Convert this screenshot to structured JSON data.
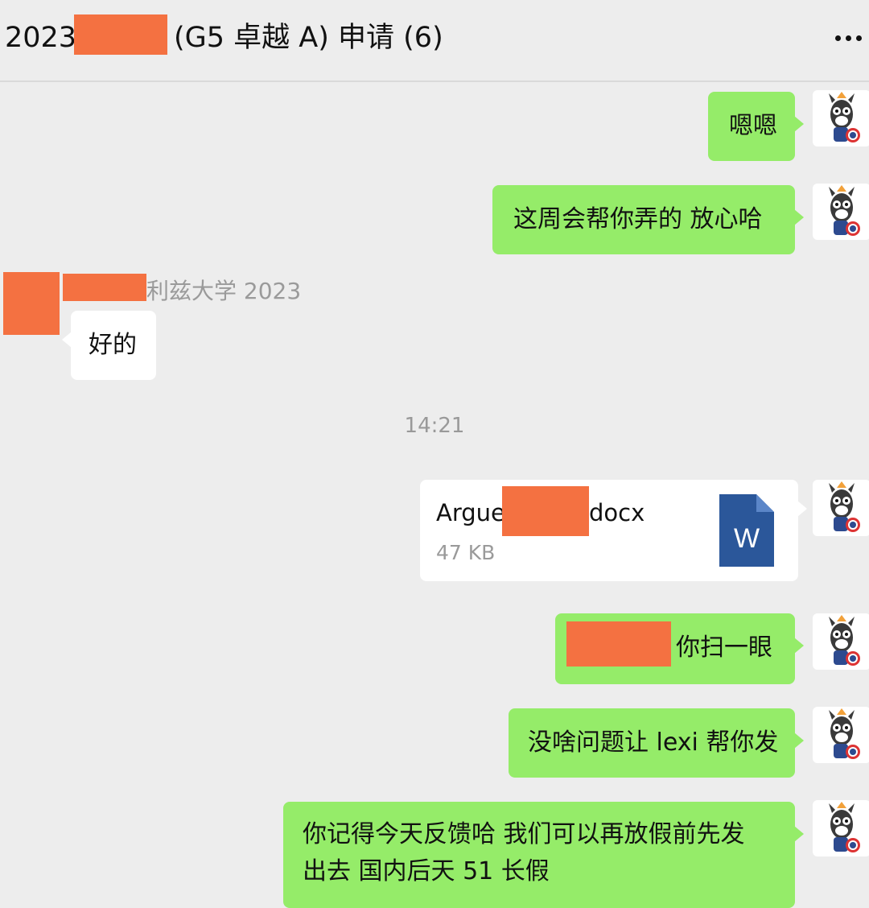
{
  "header": {
    "title_prefix": "2023",
    "title_suffix": "(G5 卓越 A) 申请 (6)",
    "more_icon": "more-dots-icon"
  },
  "messages": {
    "m1": "嗯嗯",
    "m2": "这周会帮你弄的 放心哈",
    "sender_label": "利兹大学 2023",
    "m3": "好的",
    "timestamp": "14:21",
    "file": {
      "name_prefix": "Argue",
      "name_suffix": "docx",
      "size": "47 KB",
      "icon_letter": "W"
    },
    "m5": "你扫一眼",
    "m6": "没啥问题让 lexi 帮你发",
    "m7_line1": "你记得今天反馈哈 我们可以再放假前先发",
    "m7_line2": "出去  国内后天 51 长假"
  },
  "colors": {
    "green_bubble": "#95ec69",
    "redaction": "#f47141",
    "word_blue": "#2b579a"
  }
}
